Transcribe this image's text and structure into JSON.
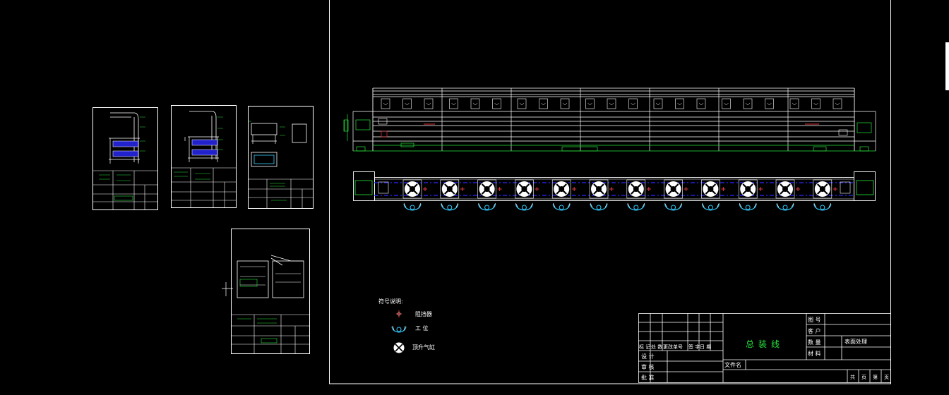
{
  "legend": {
    "title": "符号说明:",
    "items": [
      {
        "icon": "stopper-icon",
        "label": "阻挡器"
      },
      {
        "icon": "workstation-icon",
        "label": "工 位"
      },
      {
        "icon": "lift-cylinder-icon",
        "label": "顶升气缸"
      }
    ]
  },
  "title_block": {
    "drawing_title": "总装线",
    "field_drawing_no": "图 号",
    "field_customer": "客 户",
    "field_quantity": "数 量",
    "field_material": "材 料",
    "field_surface": "表面处理",
    "field_mark": "标 记",
    "field_places": "处 数",
    "field_change_no": "更改单号",
    "field_sign": "签 字",
    "field_date": "日 期",
    "field_design": "设 计",
    "field_review": "审 核",
    "field_approve": "批 准",
    "field_filename": "文件名",
    "field_total": "共",
    "field_page": "页",
    "field_sheet": "第",
    "field_page2": "页"
  },
  "colors": {
    "background": "#000000",
    "line": "#ffffff",
    "green": "#27e43a",
    "blue": "#2b2bff",
    "cyan": "#33ccff",
    "red": "#e23a3a"
  }
}
